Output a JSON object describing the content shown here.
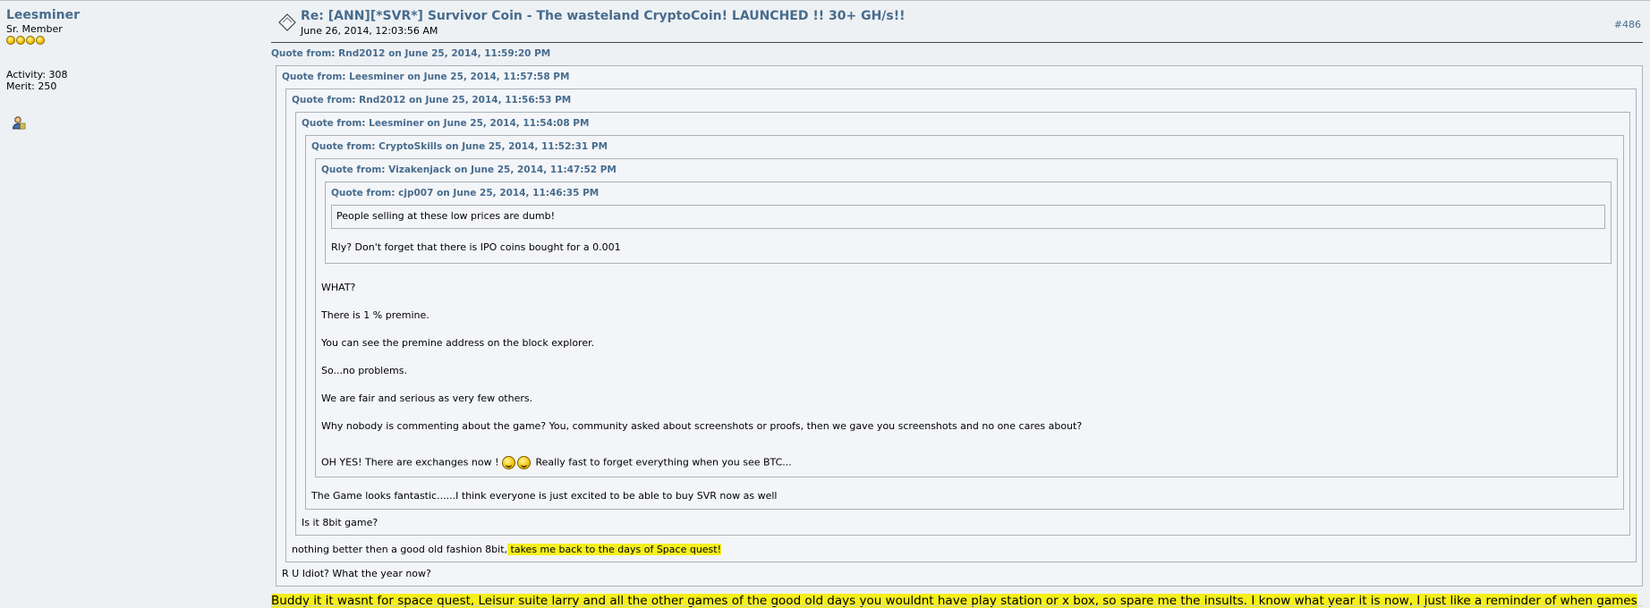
{
  "poster": {
    "name": "Leesminer",
    "rank": "Sr. Member",
    "star_count": 4,
    "activity": "Activity: 308",
    "merit": "Merit: 250"
  },
  "post": {
    "subject": "Re: [ANN][*SVR*] Survivor Coin - The wasteland CryptoCoin! LAUNCHED !! 30+ GH/s!!",
    "date": "June 26, 2014, 12:03:56 AM",
    "number": "#486"
  },
  "quotes": {
    "q1_header": "Quote from: Rnd2012 on June 25, 2014, 11:59:20 PM",
    "q2_header": "Quote from: Leesminer on June 25, 2014, 11:57:58 PM",
    "q3_header": "Quote from: Rnd2012 on June 25, 2014, 11:56:53 PM",
    "q4_header": "Quote from: Leesminer on June 25, 2014, 11:54:08 PM",
    "q5_header": "Quote from: CryptoSkills on June 25, 2014, 11:52:31 PM",
    "q6_header": "Quote from: Vizakenjack on June 25, 2014, 11:47:52 PM",
    "q7_header": "Quote from: cjp007 on June 25, 2014, 11:46:35 PM",
    "q7_text": "People selling at these low prices are dumb!",
    "q6_text": "Rly? Don't forget that there is IPO coins bought for a 0.001",
    "q5_lines": [
      "WHAT?",
      "There is 1 % premine.",
      "You can see the premine address on the block explorer.",
      "So...no problems.",
      "We are fair and serious as very few others.",
      "Why nobody is commenting about the game? You, community asked about screenshots or proofs, then we gave you screenshots and no one cares about?"
    ],
    "q5_last_before": "OH YES! There are exchanges now !",
    "q5_last_after": "Really fast to forget everything when you see BTC...",
    "q4_text": "The Game looks fantastic......I think everyone is just excited to be able to buy SVR now as well",
    "q3_text": "Is it 8bit game?",
    "q2_text_plain": "nothing better then a good old fashion 8bit,",
    "q2_text_highlight": " takes me back to the days of Space quest!",
    "q1_text": "R U Idiot? What the year now?"
  },
  "reply": {
    "text": "Buddy it it wasnt for space quest, Leisur suite larry and all the other games of the good old days you wouldnt have play station or x box, so spare me the insults.  I know what year it is now, I just like a reminder of when games were actually fun, and this game does that for me."
  },
  "colors": {
    "link": "#476c8e",
    "highlight": "#f5ef1c",
    "quote_border": "#aab2ba",
    "background": "#eef1f4"
  },
  "icons": {
    "stars": "star-icon",
    "profile": "profile-icon",
    "topic": "topic-icon",
    "smiley": "cheesy-smiley-icon"
  }
}
